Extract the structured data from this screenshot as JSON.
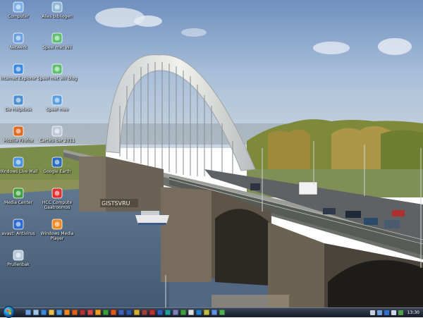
{
  "desktop": {
    "icons": [
      {
        "id": "computer",
        "label": "Computer",
        "icon": "computer-icon"
      },
      {
        "id": "bibliotheek",
        "label": "Alles bibliogen",
        "icon": "library-icon"
      },
      {
        "id": "netwerk",
        "label": "Netwerk",
        "icon": "network-icon"
      },
      {
        "id": "wii",
        "label": "Speel met Wii",
        "icon": "gamepad-icon"
      },
      {
        "id": "ie",
        "label": "Internet Explorer",
        "icon": "internet-explorer-icon"
      },
      {
        "id": "wiiblog",
        "label": "Speel met Wii blog",
        "icon": "gamepad-icon"
      },
      {
        "id": "helpdesk",
        "label": "De Helpdesk",
        "icon": "helpdesk-icon"
      },
      {
        "id": "speelmee",
        "label": "Speel mee",
        "icon": "globe-icon"
      },
      {
        "id": "firefox",
        "label": "Mozilla Firefox",
        "icon": "firefox-icon"
      },
      {
        "id": "pack",
        "label": "Cartels bar 2011",
        "icon": "package-icon"
      },
      {
        "id": "livemail",
        "label": "Windows Live Mail",
        "icon": "mail-icon"
      },
      {
        "id": "googleearth",
        "label": "Google Earth",
        "icon": "google-earth-icon"
      },
      {
        "id": "mediacenter",
        "label": "Media Center",
        "icon": "media-center-icon"
      },
      {
        "id": "hcc",
        "label": "HCC Compute Gaatroomos",
        "icon": "lifebuoy-icon"
      },
      {
        "id": "avast",
        "label": "avast! Antivirus",
        "icon": "antivirus-icon"
      },
      {
        "id": "wmp",
        "label": "Windows Media Player",
        "icon": "media-player-icon"
      },
      {
        "id": "prullenbak",
        "label": "Prullenbak",
        "icon": "recycle-bin-icon"
      }
    ],
    "wallpaper_sign": "GISTSVRU"
  },
  "taskbar": {
    "start_icon": "windows-logo-icon",
    "quicklaunch": [
      {
        "icon": "show-desktop-icon",
        "color": "#6aa0e8"
      },
      {
        "icon": "window-switcher-icon",
        "color": "#9cc6f0"
      },
      {
        "icon": "internet-explorer-icon",
        "color": "#3c8ae0"
      },
      {
        "icon": "explorer-icon",
        "color": "#e8c050"
      },
      {
        "icon": "mail-icon",
        "color": "#4a9ae0"
      },
      {
        "icon": "media-player-icon",
        "color": "#f08a20"
      },
      {
        "icon": "firefox-icon",
        "color": "#e06020"
      },
      {
        "icon": "app-icon",
        "color": "#b03030"
      },
      {
        "icon": "app-icon",
        "color": "#d84848"
      },
      {
        "icon": "app-icon",
        "color": "#f0a020"
      },
      {
        "icon": "app-icon",
        "color": "#3aa03a"
      },
      {
        "icon": "app-icon",
        "color": "#e05a20"
      },
      {
        "icon": "app-icon",
        "color": "#4060c0"
      },
      {
        "icon": "word-icon",
        "color": "#2a5ab0"
      },
      {
        "icon": "app-icon",
        "color": "#d8b030"
      },
      {
        "icon": "app-icon",
        "color": "#a04040"
      },
      {
        "icon": "app-icon",
        "color": "#c03030"
      },
      {
        "icon": "app-icon",
        "color": "#3060c0"
      },
      {
        "icon": "app-icon",
        "color": "#20a0a0"
      },
      {
        "icon": "app-icon",
        "color": "#8080c0"
      },
      {
        "icon": "app-icon",
        "color": "#40a040"
      },
      {
        "icon": "app-icon",
        "color": "#e0e0e0"
      },
      {
        "icon": "app-icon",
        "color": "#2080d0"
      },
      {
        "icon": "app-icon",
        "color": "#c0c040"
      },
      {
        "icon": "app-icon",
        "color": "#6090e0"
      },
      {
        "icon": "app-icon",
        "color": "#50b050"
      }
    ],
    "tray": [
      {
        "icon": "chevron-icon",
        "color": "#c8d0e0"
      },
      {
        "icon": "network-icon",
        "color": "#70a0e0"
      },
      {
        "icon": "antivirus-icon",
        "color": "#3070d0"
      },
      {
        "icon": "volume-icon",
        "color": "#d0d8e8"
      },
      {
        "icon": "app-icon",
        "color": "#50a050"
      }
    ],
    "clock": "13:30"
  }
}
